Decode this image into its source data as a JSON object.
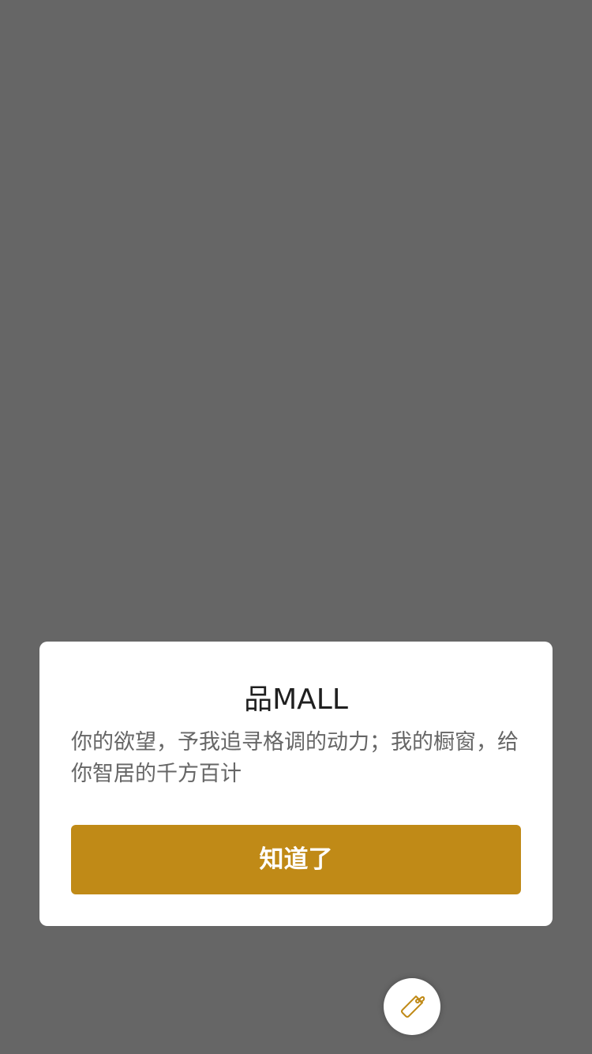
{
  "dialog": {
    "title": "品MALL",
    "description": "你的欲望，予我追寻格调的动力；我的橱窗，给你智居的千方百计",
    "confirm_label": "知道了"
  },
  "floating_button": {
    "icon": "price-tag-icon"
  },
  "colors": {
    "overlay": "#666666",
    "accent": "#c08a17",
    "dialog_background": "#ffffff"
  }
}
